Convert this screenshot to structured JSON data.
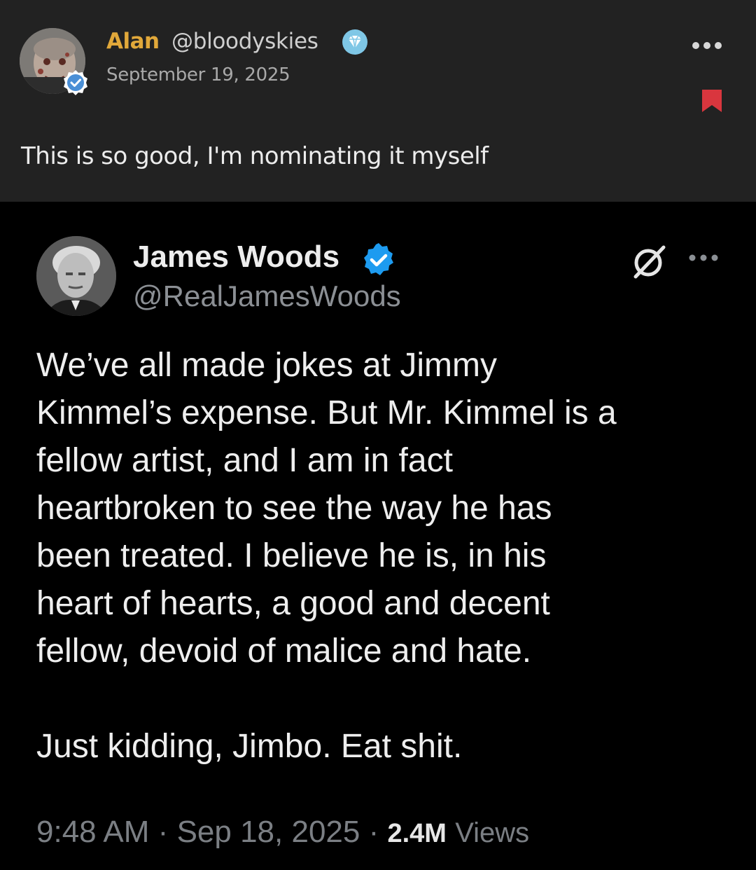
{
  "post": {
    "author_name": "Alan",
    "author_handle": "@bloodyskies",
    "date": "September 19, 2025",
    "text": "This is so good, I'm nominating it myself",
    "icons": {
      "avatar": "zombie-avatar",
      "verified": "verified-badge-icon",
      "gem": "diamond-gem-icon",
      "more": "more-options-icon",
      "bookmark": "bookmark-icon"
    },
    "colors": {
      "name": "#e1a83a",
      "bookmark": "#d9363e"
    }
  },
  "tweet": {
    "author_name": "James Woods",
    "author_handle": "@RealJamesWoods",
    "body_lines": [
      "We’ve all made jokes at Jimmy",
      "Kimmel’s expense. But Mr. Kimmel is a",
      "fellow artist, and I am in fact",
      "heartbroken to see the way he has",
      "been treated. I believe he is, in his",
      "heart of hearts, a good and decent",
      "fellow, devoid of malice and hate."
    ],
    "punchline": "Just kidding, Jimbo. Eat shit.",
    "time": "9:48 AM",
    "separator": "·",
    "date": "Sep 18, 2025",
    "views_count": "2.4M",
    "views_label": "Views",
    "icons": {
      "verified": "blue-verified-check-icon",
      "grok": "grok-icon",
      "more": "more-options-icon"
    },
    "colors": {
      "verified": "#1d9bf0"
    }
  }
}
